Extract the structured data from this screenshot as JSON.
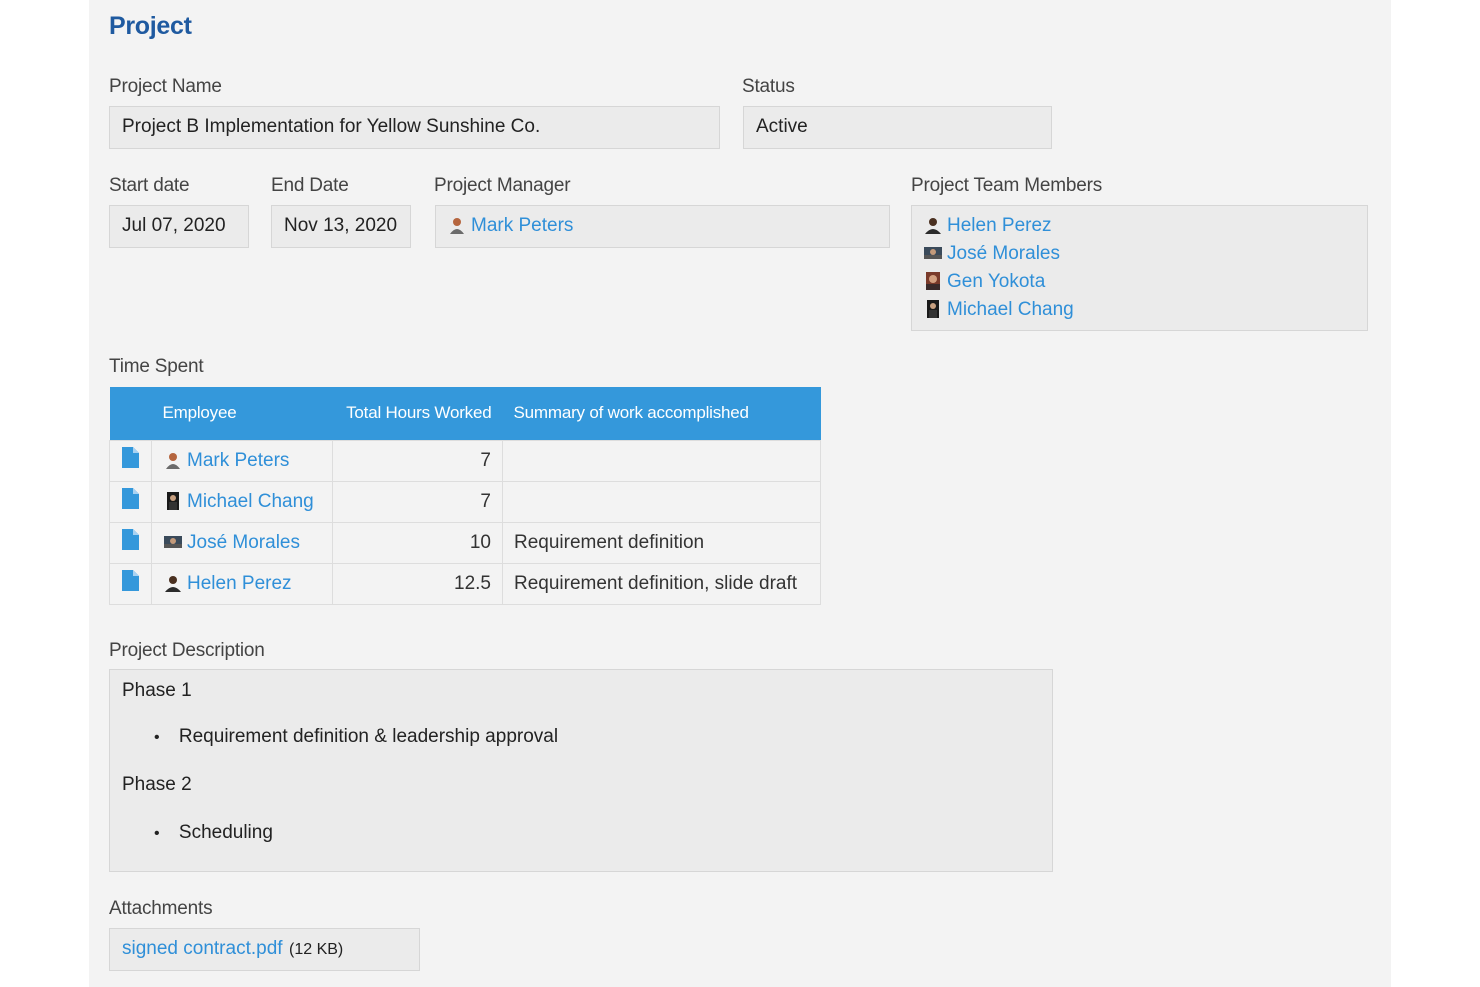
{
  "page": {
    "title": "Project"
  },
  "project_name": {
    "label": "Project Name",
    "value": "Project B Implementation for Yellow Sunshine Co."
  },
  "status": {
    "label": "Status",
    "value": "Active"
  },
  "start_date": {
    "label": "Start date",
    "value": "Jul 07, 2020"
  },
  "end_date": {
    "label": "End Date",
    "value": "Nov 13, 2020"
  },
  "project_manager": {
    "label": "Project Manager",
    "name": "Mark Peters"
  },
  "team_members": {
    "label": "Project Team Members",
    "members": [
      "Helen Perez",
      "José Morales",
      "Gen Yokota",
      "Michael Chang"
    ]
  },
  "time_spent": {
    "label": "Time Spent",
    "columns": [
      "Employee",
      "Total Hours Worked",
      "Summary of work accomplished"
    ],
    "rows": [
      {
        "employee": "Mark Peters",
        "hours": "7",
        "summary": ""
      },
      {
        "employee": "Michael Chang",
        "hours": "7",
        "summary": ""
      },
      {
        "employee": "José Morales",
        "hours": "10",
        "summary": "Requirement definition"
      },
      {
        "employee": "Helen Perez",
        "hours": "12.5",
        "summary": "Requirement definition, slide draft"
      }
    ]
  },
  "description": {
    "label": "Project Description",
    "phase1": {
      "title": "Phase 1",
      "items": [
        "Requirement definition & leadership approval"
      ]
    },
    "phase2": {
      "title": "Phase 2",
      "items": [
        "Scheduling"
      ]
    }
  },
  "attachments": {
    "label": "Attachments",
    "file_name": "signed contract.pdf",
    "file_size": "(12 KB)"
  },
  "colors": {
    "accent": "#3498db",
    "link": "#2f8fd8",
    "title": "#1f5aa0",
    "background": "#f3f3f3",
    "field": "#ebebeb"
  },
  "icons": {
    "avatar": "person-avatar-icon",
    "record": "document-icon"
  }
}
